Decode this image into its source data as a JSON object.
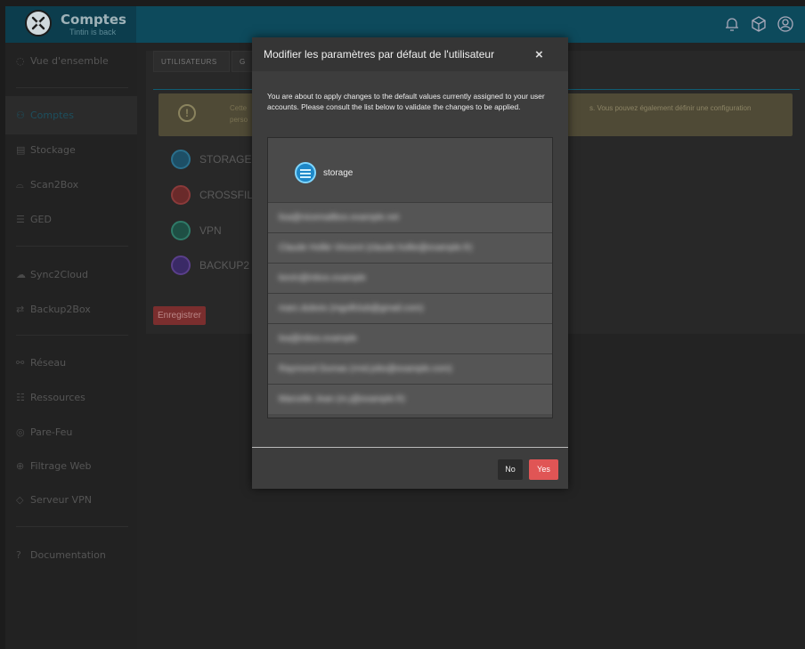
{
  "header": {
    "title": "Comptes",
    "subtitle": "Tintin is back"
  },
  "sidebar": {
    "items": [
      {
        "label": "Vue d'ensemble",
        "icon": "dashboard-icon"
      },
      {
        "label": "Comptes",
        "icon": "users-icon"
      },
      {
        "label": "Stockage",
        "icon": "storage-icon"
      },
      {
        "label": "Scan2Box",
        "icon": "scan-icon"
      },
      {
        "label": "GED",
        "icon": "document-icon"
      },
      {
        "label": "Sync2Cloud",
        "icon": "cloud-icon"
      },
      {
        "label": "Backup2Box",
        "icon": "backup-icon"
      },
      {
        "label": "Réseau",
        "icon": "network-icon"
      },
      {
        "label": "Ressources",
        "icon": "resources-icon"
      },
      {
        "label": "Pare-Feu",
        "icon": "firewall-icon"
      },
      {
        "label": "Filtrage Web",
        "icon": "globe-icon"
      },
      {
        "label": "Serveur VPN",
        "icon": "shield-icon"
      },
      {
        "label": "Documentation",
        "icon": "help-icon"
      }
    ]
  },
  "main": {
    "tabs": [
      {
        "label": "UTILISATEURS"
      },
      {
        "label": "G"
      }
    ],
    "alert": {
      "line1": "Cette",
      "line2": "perso",
      "right": "s. Vous pouvez également définir une configuration"
    },
    "services": [
      {
        "label": "STORAGE",
        "color": "#2a9fd6"
      },
      {
        "label": "CROSSFIL",
        "color": "#d64a4a"
      },
      {
        "label": "VPN",
        "color": "#2fa58a"
      },
      {
        "label": "BACKUP2",
        "color": "#8a5ad6"
      }
    ],
    "save_label": "Enregistrer"
  },
  "modal": {
    "title": "Modifier les paramètres par défaut de l'utilisateur",
    "close": "×",
    "text": "You are about to apply changes to the default values currently assigned to your user accounts. Please consult the list below to validate the changes to be applied.",
    "service": "storage",
    "rows": [
      "lisa@nicemailbox.example.net",
      "Claude Hollie Vincent (claude.hollie@example.fr)",
      "kevin@inbox.example",
      "marc.dubois (mgolfclub@gmail.com)",
      "lea@inbox.example",
      "Raymond Dumas (rmd.jobs@example.com)",
      "Marcelle Jean (m.j@example.fr)"
    ],
    "no_label": "No",
    "yes_label": "Yes"
  }
}
